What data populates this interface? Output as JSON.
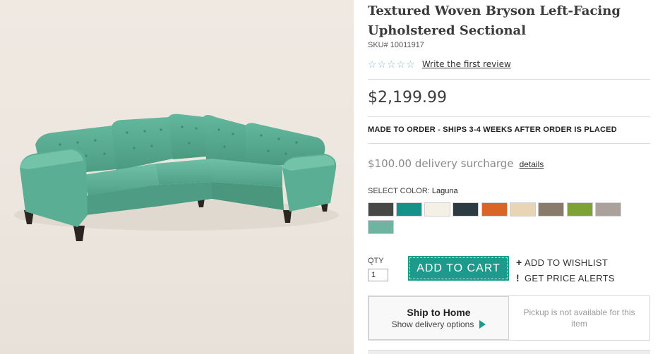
{
  "product": {
    "title": "Textured Woven Bryson Left-Facing Upholstered Sectional",
    "sku": "SKU# 10011917",
    "rating_stars": 5,
    "review_link": "Write the first review",
    "price": "$2,199.99",
    "ship_note": "MADE TO ORDER - SHIPS 3-4 WEEKS AFTER ORDER IS PLACED",
    "surcharge": "$100.00 delivery surcharge",
    "details_link": "details",
    "image_icon": "sectional-sofa-photo"
  },
  "color": {
    "label": "SELECT COLOR:",
    "selected": "Laguna",
    "swatches": [
      "#474745",
      "#159287",
      "#f4f0e6",
      "#2c3b42",
      "#d86525",
      "#e8d5b5",
      "#897b6c",
      "#7fa235",
      "#aaa29a",
      "#6db5a1"
    ]
  },
  "purchase": {
    "qty_label": "QTY",
    "qty_value": "1",
    "add_to_cart": "ADD TO CART",
    "wishlist": "ADD TO WISHLIST",
    "wishlist_mark": "+",
    "price_alerts": "GET PRICE ALERTS",
    "alerts_mark": "!"
  },
  "fulfillment": {
    "ship_title": "Ship to Home",
    "ship_sub": "Show delivery options",
    "pickup_text": "Pickup is not available for this item"
  },
  "colors": {
    "accent": "#1d9a8c",
    "star": "#8bbfd0"
  }
}
